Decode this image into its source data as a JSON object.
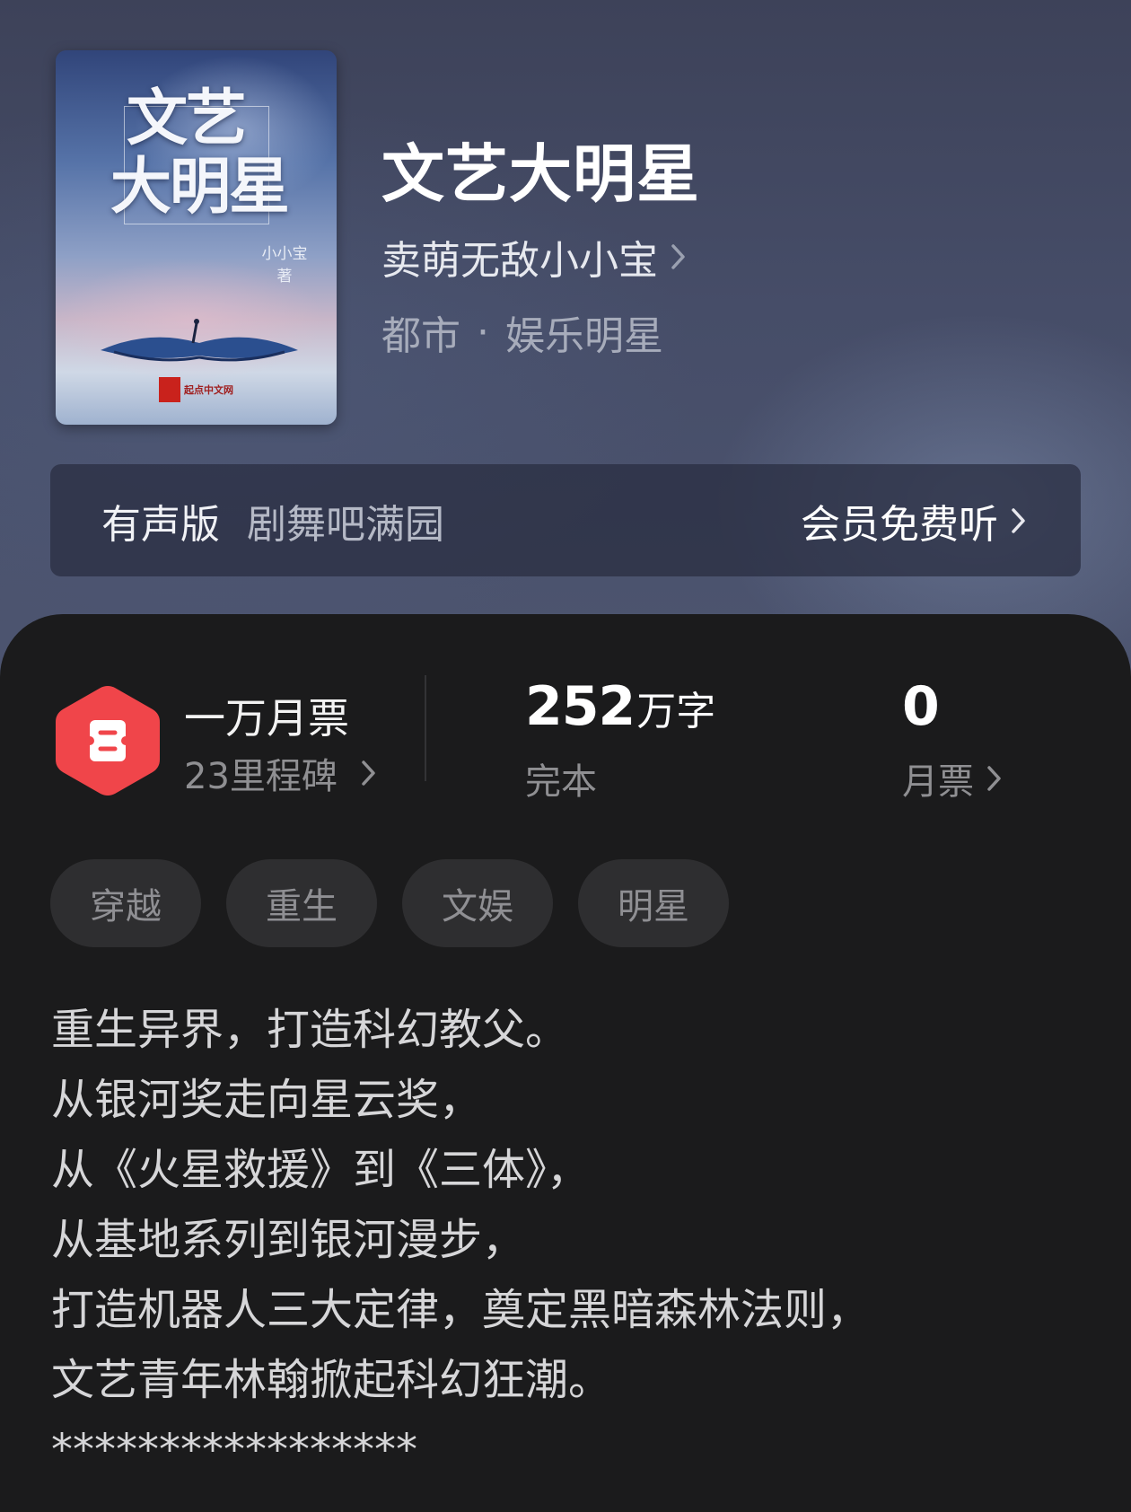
{
  "cover": {
    "title_line1": "文艺",
    "title_line2": "大明星",
    "author_text": "小小宝 著",
    "logo_text": "起点中文网"
  },
  "book": {
    "title": "文艺大明星",
    "author": "卖萌无敌小小宝",
    "genre_main": "都市",
    "genre_separator": "·",
    "genre_sub": "娱乐明星"
  },
  "audio": {
    "label": "有声版",
    "narrator": "剧舞吧满园",
    "cta": "会员免费听"
  },
  "stats": {
    "milestone_title": "一万月票",
    "milestone_sub": "23里程碑",
    "word_count": "252",
    "word_unit": "万字",
    "status": "完本",
    "monthly_votes": "0",
    "monthly_votes_label": "月票"
  },
  "tags": [
    "穿越",
    "重生",
    "文娱",
    "明星"
  ],
  "description": [
    "重生异界，打造科幻教父。",
    "从银河奖走向星云奖，",
    "从《火星救援》到《三体》，",
    "从基地系列到银河漫步，",
    "打造机器人三大定律，奠定黑暗森林法则，",
    "文艺青年林翰掀起科幻狂潮。",
    "*****************"
  ],
  "colors": {
    "badge_red": "#f0454a",
    "card_background": "#1b1b1c",
    "hero_background": "#464d68"
  },
  "icons": {
    "ticket_badge": "ticket-hexagon-icon",
    "chevron": "chevron-right-icon"
  }
}
